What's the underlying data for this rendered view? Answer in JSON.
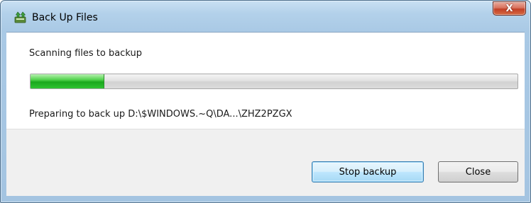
{
  "window": {
    "title": "Back Up Files",
    "close_glyph": "X",
    "icon": "backup-app-icon"
  },
  "main": {
    "status_heading": "Scanning files to backup",
    "progress": {
      "fraction": 0.15,
      "color": "#1aa81d"
    },
    "detail": "Preparing to back up D:\\$WINDOWS.~Q\\DA...\\ZHZ2PZGX"
  },
  "footer": {
    "stop_label": "Stop backup",
    "close_label": "Close"
  }
}
